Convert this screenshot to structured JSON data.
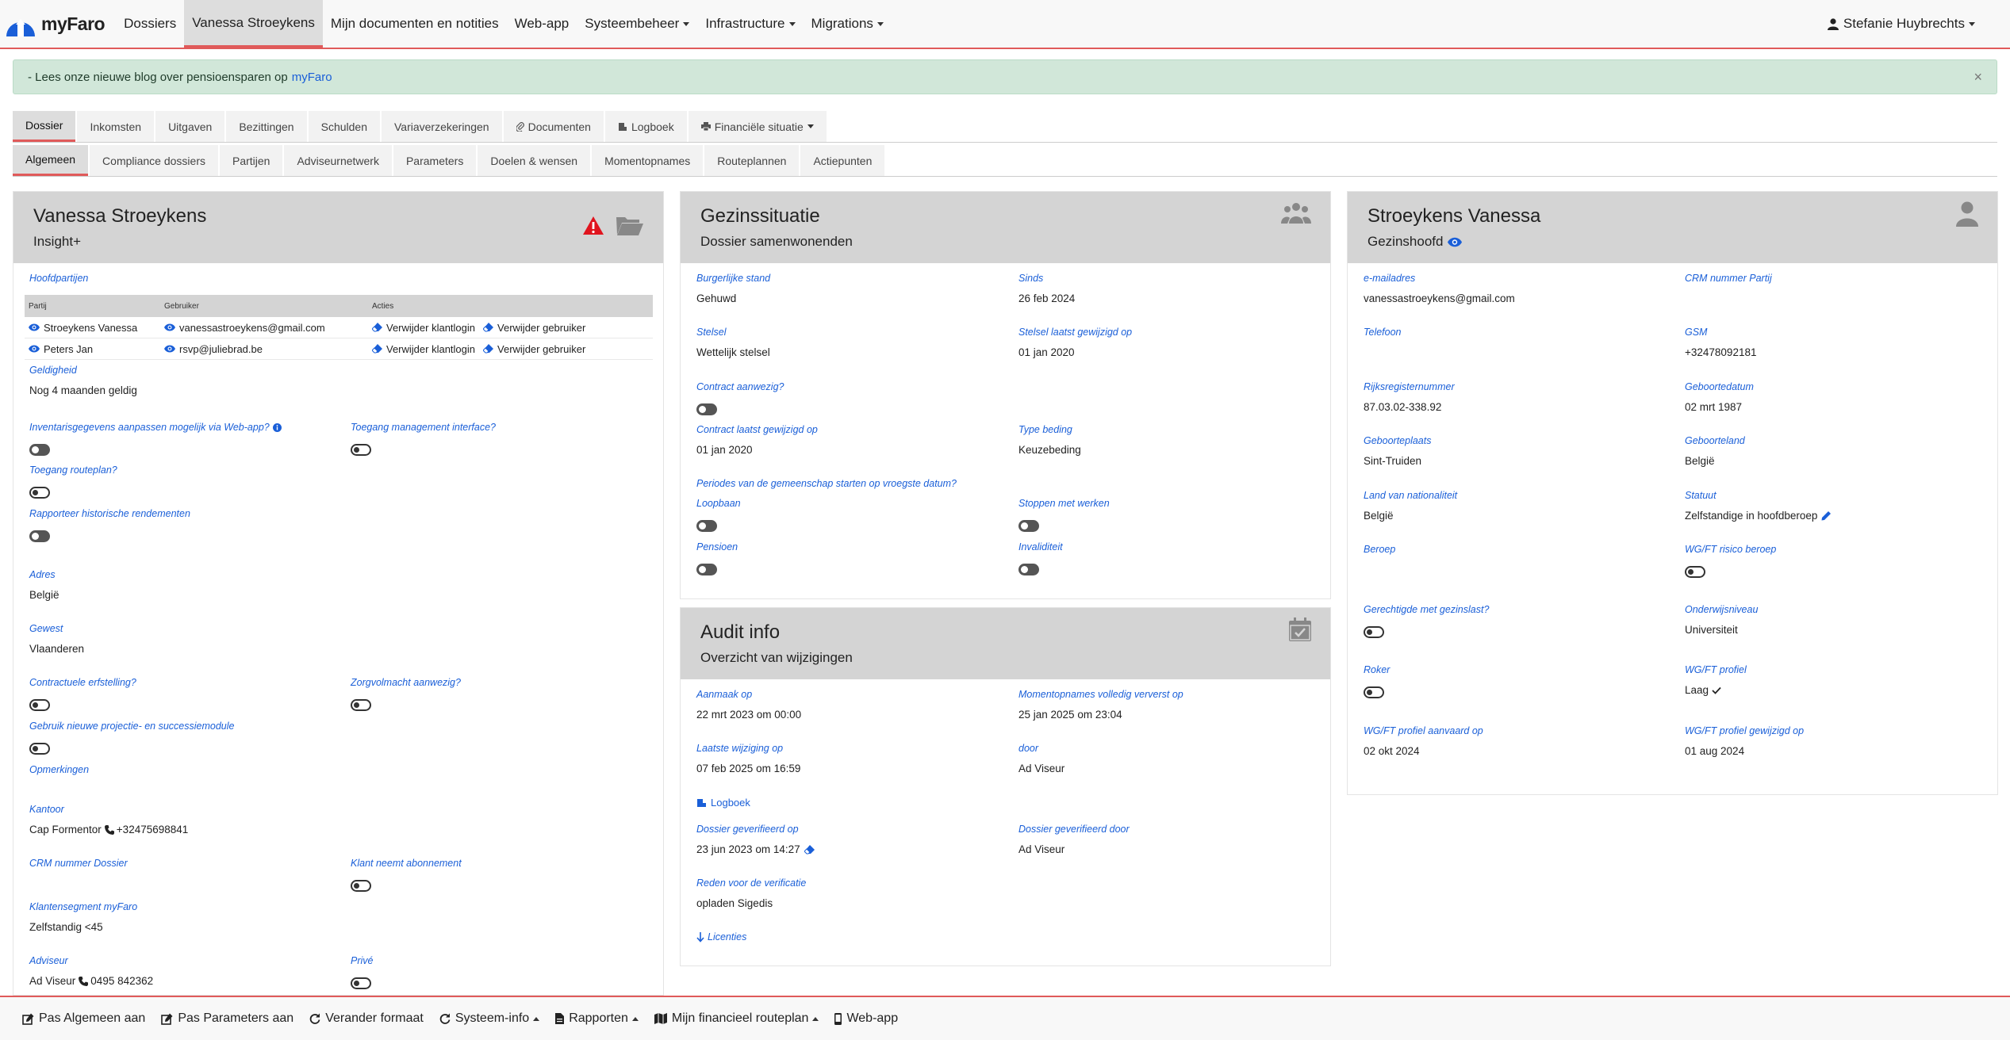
{
  "navbar": {
    "brand": "myFaro",
    "items": [
      {
        "label": "Dossiers"
      },
      {
        "label": "Vanessa Stroeykens"
      },
      {
        "label": "Mijn documenten en notities"
      },
      {
        "label": "Web-app"
      },
      {
        "label": "Systeembeheer"
      },
      {
        "label": "Infrastructure"
      },
      {
        "label": "Migrations"
      }
    ],
    "user": "Stefanie Huybrechts"
  },
  "alert": {
    "text": "- Lees onze nieuwe blog over pensioensparen op",
    "link": "myFaro",
    "close": "×"
  },
  "tabs_main": [
    "Dossier",
    "Inkomsten",
    "Uitgaven",
    "Bezittingen",
    "Schulden",
    "Variaverzekeringen",
    "Documenten",
    "Logboek",
    "Financiële situatie"
  ],
  "tabs_sub": [
    "Algemeen",
    "Compliance dossiers",
    "Partijen",
    "Adviseurnetwerk",
    "Parameters",
    "Doelen & wensen",
    "Momentopnames",
    "Routeplannen",
    "Actiepunten"
  ],
  "panel1": {
    "title": "Vanessa Stroeykens",
    "subtitle": "Insight+",
    "hoofdpartijen_label": "Hoofdpartijen",
    "table_headers": [
      "Partij",
      "Gebruiker",
      "Acties"
    ],
    "rows": [
      {
        "partij": "Stroeykens Vanessa",
        "gebruiker": "vanessastroeykens@gmail.com",
        "act1": "Verwijder klantlogin",
        "act2": "Verwijder gebruiker"
      },
      {
        "partij": "Peters Jan",
        "gebruiker": "rsvp@juliebrad.be",
        "act1": "Verwijder klantlogin",
        "act2": "Verwijder gebruiker"
      }
    ],
    "geldigheid_label": "Geldigheid",
    "geldigheid_value": "Nog 4 maanden geldig",
    "inventaris_label": "Inventarisgegevens aanpassen mogelijk via Web-app?",
    "toegang_mgmt_label": "Toegang management interface?",
    "toegang_route_label": "Toegang routeplan?",
    "rapporteer_label": "Rapporteer historische rendementen",
    "adres_label": "Adres",
    "adres_value": "België",
    "gewest_label": "Gewest",
    "gewest_value": "Vlaanderen",
    "erfstelling_label": "Contractuele erfstelling?",
    "zorgvolmacht_label": "Zorgvolmacht aanwezig?",
    "projectie_label": "Gebruik nieuwe projectie- en successiemodule",
    "opmerkingen_label": "Opmerkingen",
    "kantoor_label": "Kantoor",
    "kantoor_name": "Cap Formentor",
    "kantoor_phone": "+32475698841",
    "crm_dossier_label": "CRM nummer Dossier",
    "abonnement_label": "Klant neemt abonnement",
    "segment_label": "Klantensegment myFaro",
    "segment_value": "Zelfstandig <45",
    "adviseur_label": "Adviseur",
    "adviseur_name": "Ad Viseur",
    "adviseur_phone": "0495 842362",
    "prive_label": "Privé"
  },
  "panel2": {
    "title": "Gezinssituatie",
    "subtitle": "Dossier samenwonenden",
    "burgerlijke_label": "Burgerlijke stand",
    "burgerlijke_value": "Gehuwd",
    "sinds_label": "Sinds",
    "sinds_value": "26 feb 2024",
    "stelsel_label": "Stelsel",
    "stelsel_value": "Wettelijk stelsel",
    "stelsel_gewijzigd_label": "Stelsel laatst gewijzigd op",
    "stelsel_gewijzigd_value": "01 jan 2020",
    "contract_label": "Contract aanwezig?",
    "contract_gewijzigd_label": "Contract laatst gewijzigd op",
    "contract_gewijzigd_value": "01 jan 2020",
    "type_beding_label": "Type beding",
    "type_beding_value": "Keuzebeding",
    "periodes_label": "Periodes van de gemeenschap starten op vroegste datum?",
    "loopbaan_label": "Loopbaan",
    "stoppen_label": "Stoppen met werken",
    "pensioen_label": "Pensioen",
    "invaliditeit_label": "Invaliditeit"
  },
  "panel3": {
    "title": "Audit info",
    "subtitle": "Overzicht van wijzigingen",
    "aanmaak_label": "Aanmaak op",
    "aanmaak_value": "22 mrt 2023 om 00:00",
    "momentopnames_label": "Momentopnames volledig ververst op",
    "momentopnames_value": "25 jan 2025 om 23:04",
    "laatste_label": "Laatste wijziging op",
    "laatste_value": "07 feb 2025 om 16:59",
    "door_label": "door",
    "door_value": "Ad Viseur",
    "logboek_link": "Logboek",
    "geverifieerd_op_label": "Dossier geverifieerd op",
    "geverifieerd_op_value": "23 jun 2023 om 14:27",
    "geverifieerd_door_label": "Dossier geverifieerd door",
    "geverifieerd_door_value": "Ad Viseur",
    "reden_label": "Reden voor de verificatie",
    "reden_value": "opladen Sigedis",
    "licenties_link": "Licenties"
  },
  "panel4": {
    "title": "Stroeykens Vanessa",
    "subtitle": "Gezinshoofd",
    "email_label": "e-mailadres",
    "email_value": "vanessastroeykens@gmail.com",
    "crm_partij_label": "CRM nummer Partij",
    "telefoon_label": "Telefoon",
    "gsm_label": "GSM",
    "gsm_value": "+32478092181",
    "rijksregister_label": "Rijksregisternummer",
    "rijksregister_value": "87.03.02-338.92",
    "geboortedatum_label": "Geboortedatum",
    "geboortedatum_value": "02 mrt 1987",
    "geboorteplaats_label": "Geboorteplaats",
    "geboorteplaats_value": "Sint-Truiden",
    "geboorteland_label": "Geboorteland",
    "geboorteland_value": "België",
    "nationaliteit_label": "Land van nationaliteit",
    "nationaliteit_value": "België",
    "statuut_label": "Statuut",
    "statuut_value": "Zelfstandige in hoofdberoep",
    "beroep_label": "Beroep",
    "risico_label": "WG/FT risico beroep",
    "gezinslast_label": "Gerechtigde met gezinslast?",
    "onderwijs_label": "Onderwijsniveau",
    "onderwijs_value": "Universiteit",
    "roker_label": "Roker",
    "wgft_profiel_label": "WG/FT profiel",
    "wgft_profiel_value": "Laag",
    "aanvaard_label": "WG/FT profiel aanvaard op",
    "aanvaard_value": "02 okt 2024",
    "gewijzigd_label": "WG/FT profiel gewijzigd op",
    "gewijzigd_value": "01 aug 2024"
  },
  "footer": {
    "items": [
      "Pas Algemeen aan",
      "Pas Parameters aan",
      "Verander formaat",
      "Systeem-info",
      "Rapporten",
      "Mijn financieel routeplan",
      "Web-app"
    ]
  },
  "colors": {
    "accent": "#e05a5a",
    "link": "#1a5fd8",
    "panel_head": "#d4d4d4",
    "alert_bg": "#d1e7d9"
  }
}
